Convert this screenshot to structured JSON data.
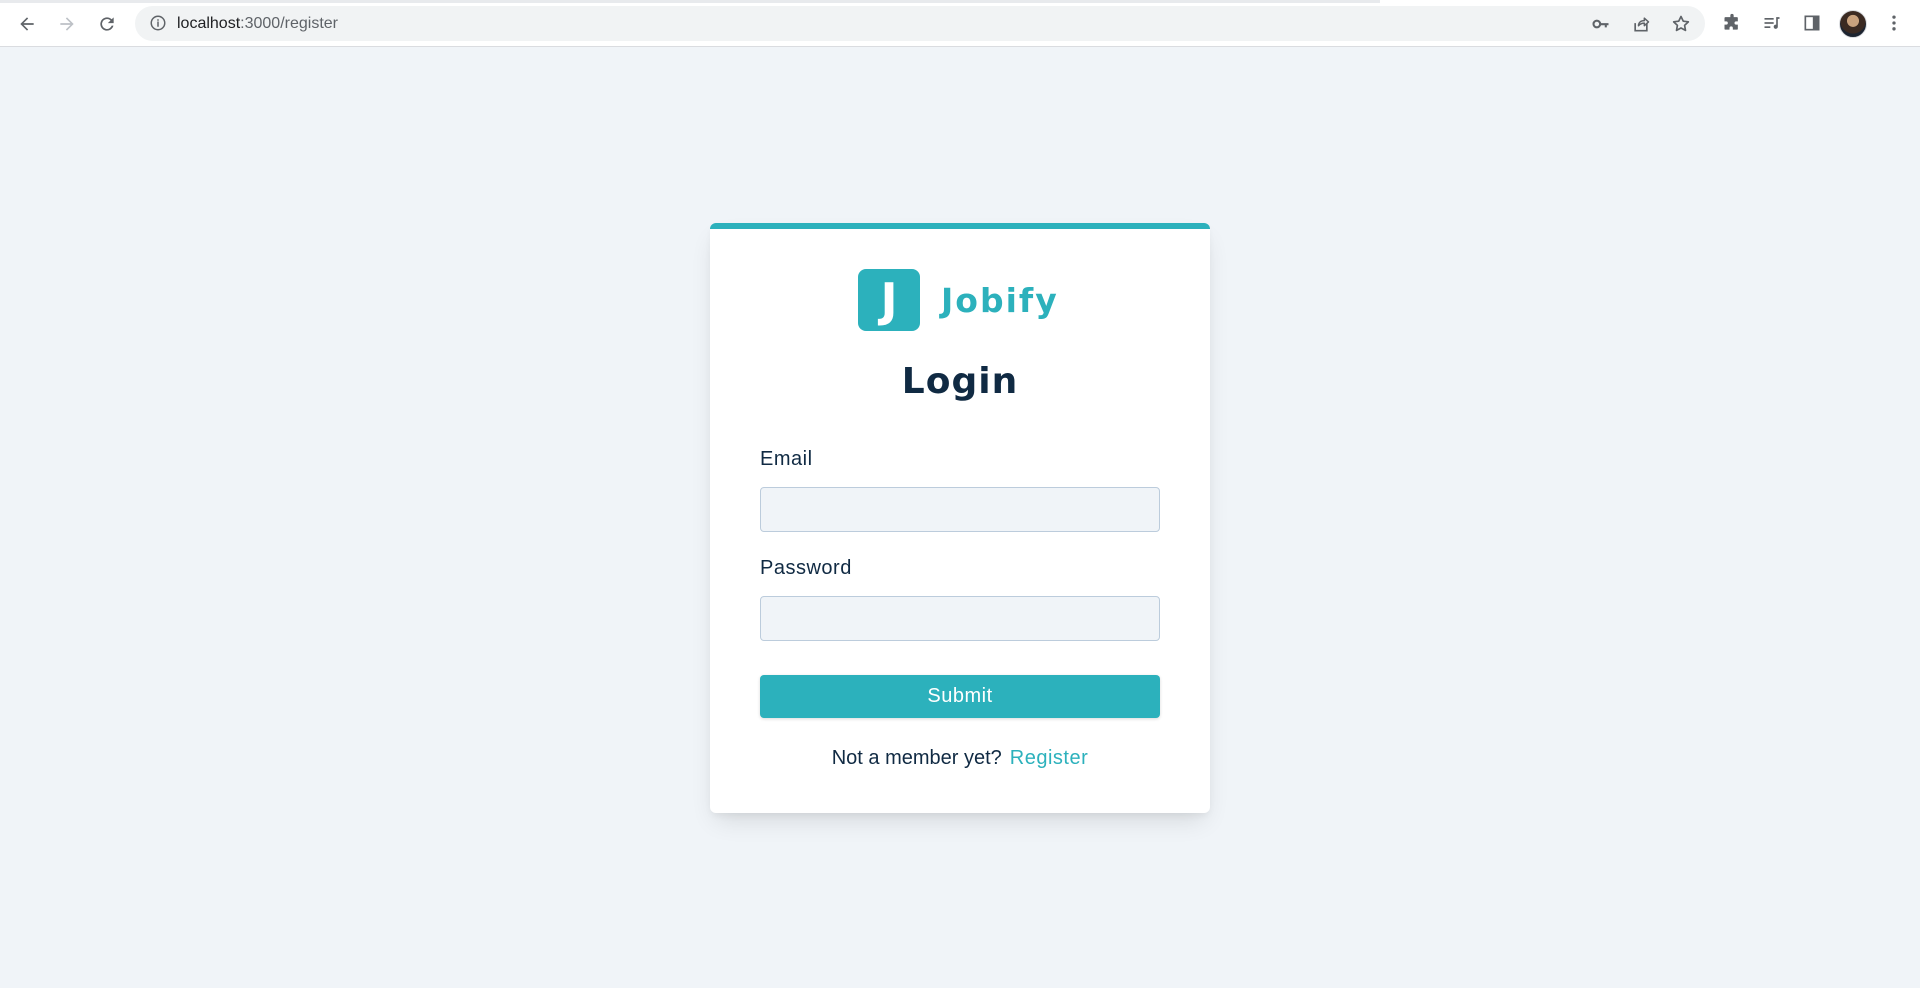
{
  "browser": {
    "url_host": "localhost",
    "url_path": ":3000/register"
  },
  "app": {
    "logo_letter": "J",
    "name": "Jobify"
  },
  "form": {
    "title": "Login",
    "email": {
      "label": "Email",
      "value": "",
      "placeholder": ""
    },
    "password": {
      "label": "Password",
      "value": "",
      "placeholder": ""
    },
    "submit_label": "Submit"
  },
  "footer": {
    "prompt": "Not a member yet?",
    "link_label": "Register"
  },
  "colors": {
    "primary": "#2cb1bc",
    "background": "#f0f4f8",
    "text": "#102a43",
    "input_border": "#bcccdc"
  }
}
